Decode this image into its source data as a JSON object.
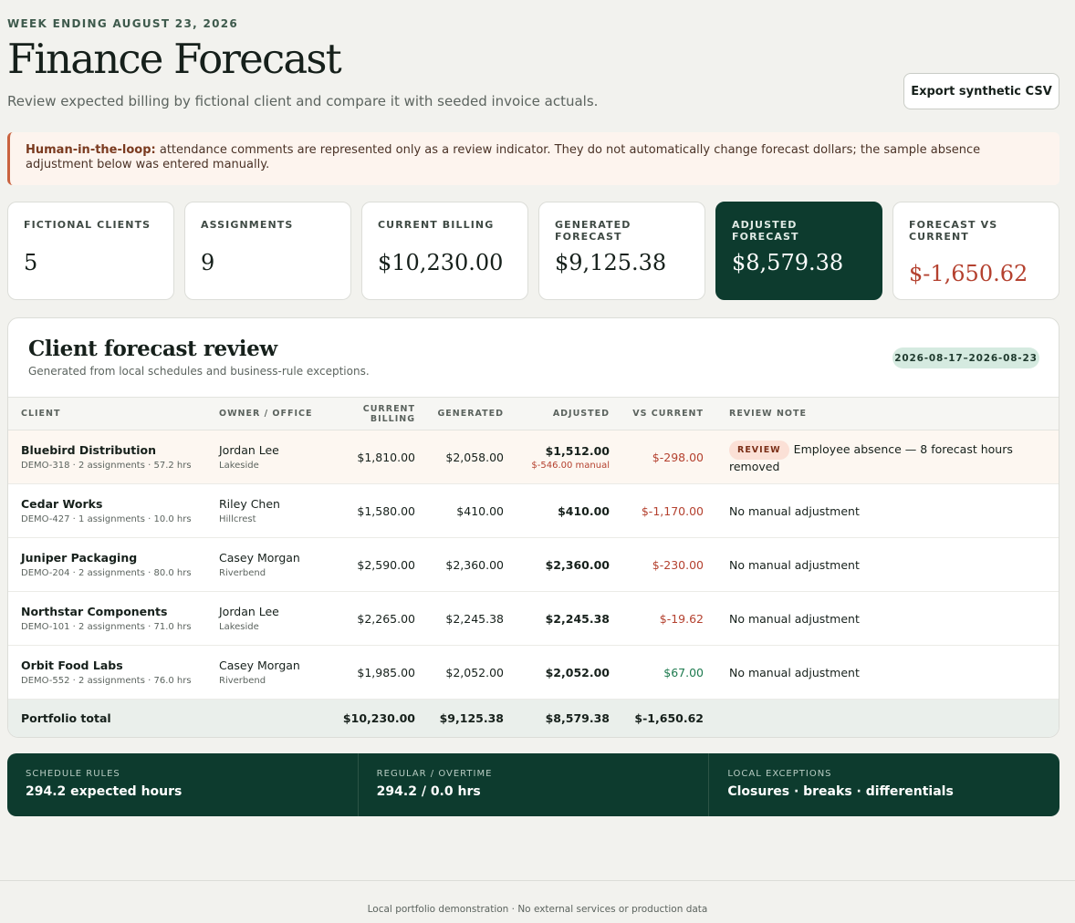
{
  "header": {
    "eyebrow": "WEEK ENDING AUGUST 23, 2026",
    "title": "Finance Forecast",
    "subtitle": "Review expected billing by fictional client and compare it with seeded invoice actuals.",
    "export_label": "Export synthetic CSV"
  },
  "notice": {
    "lead": "Human-in-the-loop:",
    "text": " attendance comments are represented only as a review indicator. They do not automatically change forecast dollars; the sample absence adjustment below was entered manually."
  },
  "kpis": [
    {
      "label": "FICTIONAL CLIENTS",
      "value": "5"
    },
    {
      "label": "ASSIGNMENTS",
      "value": "9"
    },
    {
      "label": "CURRENT BILLING",
      "value": "$10,230.00"
    },
    {
      "label": "GENERATED FORECAST",
      "value": "$9,125.38"
    },
    {
      "label": "ADJUSTED FORECAST",
      "value": "$8,579.38"
    },
    {
      "label": "FORECAST VS CURRENT",
      "value": "$-1,650.62"
    }
  ],
  "review": {
    "title": "Client forecast review",
    "subtitle": "Generated from local schedules and business-rule exceptions.",
    "date_range": "2026-08-17–2026-08-23",
    "columns": {
      "client": "CLIENT",
      "owner": "OWNER / OFFICE",
      "current": "CURRENT BILLING",
      "generated": "GENERATED",
      "adjusted": "ADJUSTED",
      "vs": "VS CURRENT",
      "note": "REVIEW NOTE"
    },
    "rows": [
      {
        "client": "Bluebird Distribution",
        "meta": "DEMO-318 · 2 assignments · 57.2 hrs",
        "owner": "Jordan Lee",
        "office": "Lakeside",
        "current": "$1,810.00",
        "generated": "$2,058.00",
        "adjusted": "$1,512.00",
        "manual": "$-546.00 manual",
        "vs": "$-298.00",
        "badge": "REVIEW",
        "note": "Employee absence — 8 forecast hours removed"
      },
      {
        "client": "Cedar Works",
        "meta": "DEMO-427 · 1 assignments · 10.0 hrs",
        "owner": "Riley Chen",
        "office": "Hillcrest",
        "current": "$1,580.00",
        "generated": "$410.00",
        "adjusted": "$410.00",
        "vs": "$-1,170.00",
        "note": "No manual adjustment"
      },
      {
        "client": "Juniper Packaging",
        "meta": "DEMO-204 · 2 assignments · 80.0 hrs",
        "owner": "Casey Morgan",
        "office": "Riverbend",
        "current": "$2,590.00",
        "generated": "$2,360.00",
        "adjusted": "$2,360.00",
        "vs": "$-230.00",
        "note": "No manual adjustment"
      },
      {
        "client": "Northstar Components",
        "meta": "DEMO-101 · 2 assignments · 71.0 hrs",
        "owner": "Jordan Lee",
        "office": "Lakeside",
        "current": "$2,265.00",
        "generated": "$2,245.38",
        "adjusted": "$2,245.38",
        "vs": "$-19.62",
        "note": "No manual adjustment"
      },
      {
        "client": "Orbit Food Labs",
        "meta": "DEMO-552 · 2 assignments · 76.0 hrs",
        "owner": "Casey Morgan",
        "office": "Riverbend",
        "current": "$1,985.00",
        "generated": "$2,052.00",
        "adjusted": "$2,052.00",
        "vs": "$67.00",
        "note": "No manual adjustment"
      }
    ],
    "total": {
      "label": "Portfolio total",
      "current": "$10,230.00",
      "generated": "$9,125.38",
      "adjusted": "$8,579.38",
      "vs": "$-1,650.62"
    }
  },
  "rules": [
    {
      "label": "SCHEDULE RULES",
      "value": "294.2 expected hours"
    },
    {
      "label": "REGULAR / OVERTIME",
      "value": "294.2 / 0.0 hrs"
    },
    {
      "label": "LOCAL EXCEPTIONS",
      "value": "Closures · breaks · differentials"
    }
  ],
  "footer": {
    "text": "Local portfolio demonstration · No external services or production data"
  },
  "colors": {
    "brand_dark": "#0d3b2e",
    "negative": "#b4412f",
    "positive": "#1e7a4f",
    "notice_accent": "#c9623e"
  }
}
